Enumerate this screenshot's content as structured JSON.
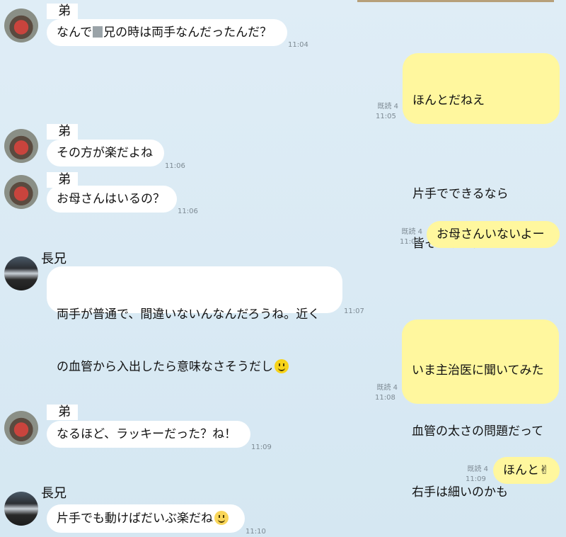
{
  "messages": [
    {
      "sender": "弟",
      "text_before": "なんで",
      "text_after": "兄の時は両手なんだったんだ？",
      "time": "11:04"
    },
    {
      "lines": [
        "ほんとだねえ",
        "",
        "片手でできるなら",
        "皆そうすればいいのにね"
      ],
      "read": "既読 4",
      "time": "11:05"
    },
    {
      "sender": "弟",
      "text": "その方が楽だよね",
      "time": "11:06"
    },
    {
      "sender": "弟",
      "text": "お母さんはいるの？",
      "time": "11:06"
    },
    {
      "text": "お母さんいないよー",
      "read": "既読 4",
      "time": "11:07"
    },
    {
      "sender": "長兄",
      "lines": [
        "両手が普通で、間違いないんなんだろうね。近く",
        "の血管から入出したら意味なさそうだし"
      ],
      "emoji": "smile-emoji",
      "time": "11:07"
    },
    {
      "lines": [
        "いま主治医に聞いてみた",
        "血管の太さの問題だって",
        "右手は細いのかも"
      ],
      "read": "既読 4",
      "time": "11:08"
    },
    {
      "sender": "弟",
      "text": "なるほど、ラッキーだった？ね！",
      "time": "11:09"
    },
    {
      "text": "ほんと✌",
      "read": "既読 4",
      "time": "11:09"
    },
    {
      "sender": "長兄",
      "text": "片手でも動けばだいぶ楽だね",
      "emoji": "blush-emoji",
      "time": "11:10"
    }
  ]
}
